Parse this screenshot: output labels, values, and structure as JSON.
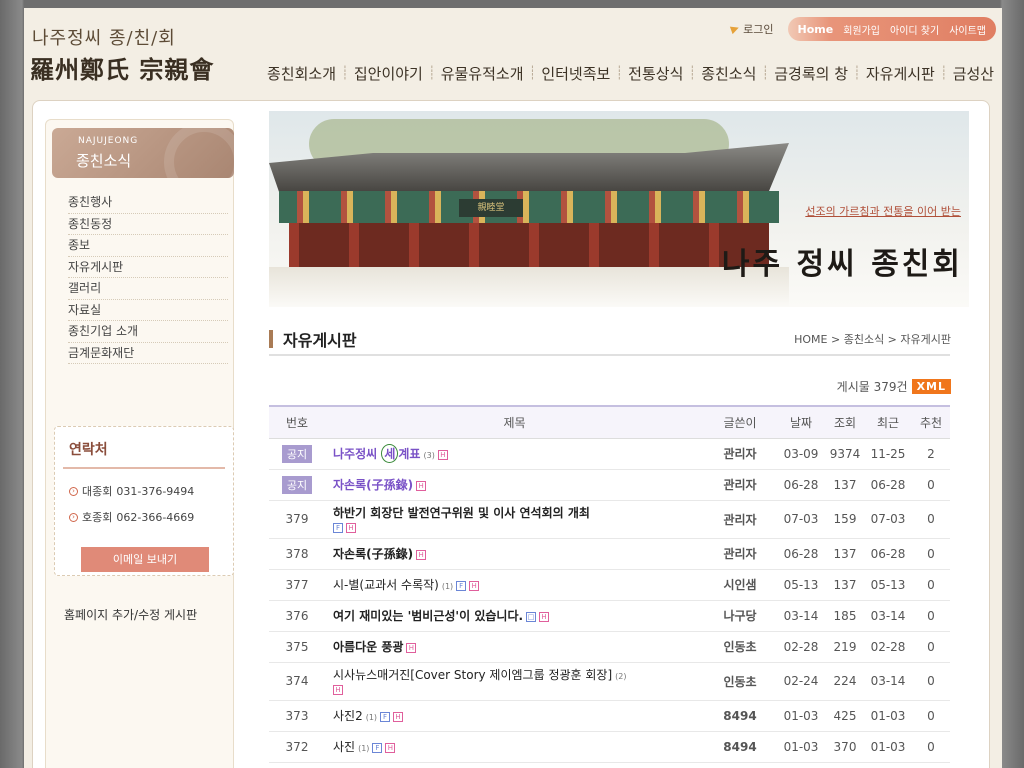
{
  "header": {
    "logo_small": "나주정씨 종/친/회",
    "logo_large": "羅州鄭氏 宗親會",
    "login": "로그인",
    "util": [
      "Home",
      "회원가입",
      "아이디 찾기",
      "사이트맵"
    ],
    "gnb": [
      "종친회소개",
      "집안이야기",
      "유물유적소개",
      "인터넷족보",
      "전통상식",
      "종친소식",
      "금경록의 창",
      "자유게시판",
      "금성산"
    ]
  },
  "sidebar": {
    "head_en": "NAJUJEONG",
    "head_ko": "종친소식",
    "items": [
      "종친행사",
      "종친동정",
      "종보",
      "자유게시판",
      "갤러리",
      "자료실",
      "종친기업 소개",
      "금계문화재단"
    ],
    "contact_title": "연락처",
    "phones": [
      {
        "label": "대종회",
        "number": "031-376-9494"
      },
      {
        "label": "호종회",
        "number": "062-366-4669"
      }
    ],
    "email_button": "이메일 보내기",
    "footer_link": "홈페이지 추가/수정 게시판"
  },
  "banner": {
    "sign": "親睦堂",
    "subtitle": "선조의 가르침과 전통을 이어 받는",
    "title": "나주 정씨 종친회"
  },
  "board": {
    "title": "자유게시판",
    "breadcrumb": "HOME > 종친소식 > 자유게시판",
    "count_label": "게시물 379건",
    "xml": "XML",
    "columns": [
      "번호",
      "제목",
      "글쓴이",
      "날짜",
      "조회",
      "최근",
      "추천"
    ],
    "rows": [
      {
        "no": "공지",
        "title_a": "나주정씨 ",
        "title_b": "세",
        "title_c": "계표",
        "comments": "(3)",
        "author": "관리자",
        "date": "03-09",
        "views": "9374",
        "recent": "11-25",
        "rec": "2"
      },
      {
        "no": "공지",
        "title": "자손록(子孫錄)",
        "author": "관리자",
        "date": "06-28",
        "views": "137",
        "recent": "06-28",
        "rec": "0"
      },
      {
        "no": "379",
        "title": "하반기 회장단 발전연구위원 및 이사 연석회의 개최",
        "author": "관리자",
        "date": "07-03",
        "views": "159",
        "recent": "07-03",
        "rec": "0"
      },
      {
        "no": "378",
        "title": "자손록(子孫錄)",
        "author": "관리자",
        "date": "06-28",
        "views": "137",
        "recent": "06-28",
        "rec": "0"
      },
      {
        "no": "377",
        "title": "시-별(교과서 수록작)",
        "comments": "(1)",
        "author": "시인샘",
        "date": "05-13",
        "views": "137",
        "recent": "05-13",
        "rec": "0"
      },
      {
        "no": "376",
        "title": "여기 재미있는 '범비근성'이 있습니다.",
        "author": "나구당",
        "date": "03-14",
        "views": "185",
        "recent": "03-14",
        "rec": "0"
      },
      {
        "no": "375",
        "title": "아름다운 풍광",
        "author": "인동초",
        "date": "02-28",
        "views": "219",
        "recent": "02-28",
        "rec": "0"
      },
      {
        "no": "374",
        "title": "시사뉴스매거진[Cover Story 제이엠그룹 정광훈 회장]",
        "comments": "(2)",
        "author": "인동초",
        "date": "02-24",
        "views": "224",
        "recent": "03-14",
        "rec": "0"
      },
      {
        "no": "373",
        "title": "사진2",
        "comments": "(1)",
        "author": "8494",
        "date": "01-03",
        "views": "425",
        "recent": "01-03",
        "rec": "0"
      },
      {
        "no": "372",
        "title": "사진",
        "comments": "(1)",
        "author": "8494",
        "date": "01-03",
        "views": "370",
        "recent": "01-03",
        "rec": "0"
      }
    ]
  },
  "icons": {
    "file": "F",
    "hot": "H",
    "image": "□"
  }
}
